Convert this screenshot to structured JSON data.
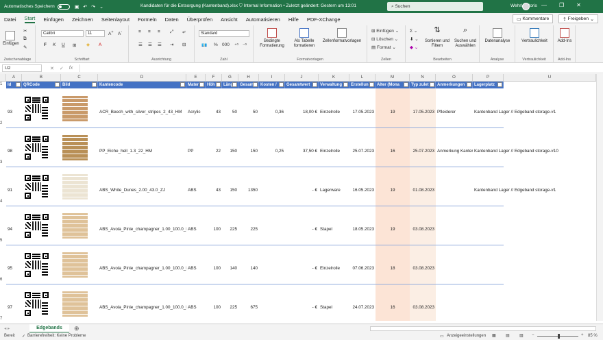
{
  "titlebar": {
    "autosave": "Automatisches Speichern",
    "filename": "Kandidaten für die Entsorgung (Kantenband).xlsx",
    "info": "Internal Information • Zuletzt geändert: Gestern um 13:01",
    "search": "Suchen",
    "user": "Wehrle, Boris"
  },
  "menu": {
    "items": [
      "Datei",
      "Start",
      "Einfügen",
      "Zeichnen",
      "Seitenlayout",
      "Formeln",
      "Daten",
      "Überprüfen",
      "Ansicht",
      "Automatisieren",
      "Hilfe",
      "PDF-XChange"
    ],
    "kommentare": "Kommentare",
    "freigeben": "Freigeben"
  },
  "ribbon": {
    "einfuegen": "Einfügen",
    "clip_label": "Zwischenablage",
    "font": "Calibri",
    "size": "11",
    "font_label": "Schriftart",
    "align_label": "Ausrichtung",
    "numfmt": "Standard",
    "num_label": "Zahl",
    "bedingte": "Bedingte Formatierung",
    "tabelle": "Als Tabelle formatieren",
    "zellenformat": "Zellenformatvorlagen",
    "formatvorlagen_label": "Formatvorlagen",
    "z_einfuegen": "Einfügen",
    "z_loeschen": "Löschen",
    "z_format": "Format",
    "zellen_label": "Zellen",
    "sortieren": "Sortieren und Filtern",
    "suchen": "Suchen und Auswählen",
    "bearbeiten_label": "Bearbeiten",
    "datenanalyse": "Datenanalyse",
    "analyse_label": "Analyse",
    "vertraulichkeit": "Vertraulichkeit",
    "vertr_label": "Vertraulichkeit",
    "addins": "Add-Ins",
    "addins_label": "Add-Ins"
  },
  "formula": {
    "namebox": "U2",
    "fx": "fx"
  },
  "columns": [
    "A",
    "B",
    "C",
    "D",
    "E",
    "F",
    "G",
    "H",
    "I",
    "J",
    "K",
    "L",
    "M",
    "N",
    "O",
    "P",
    "Q",
    "R",
    "S",
    "T",
    "U"
  ],
  "headers": [
    "Id",
    "QRCode",
    "Bild",
    "Kantencode",
    "Mater",
    "Höh",
    "Läng",
    "Gesam",
    "Kosten /",
    "Gesamtwert",
    "Verwaltung",
    "Erstellun",
    "Alter (Mona",
    "Typ zulet",
    "Anmerkungen",
    "Lagerplatz"
  ],
  "rows": [
    {
      "rn": "2",
      "id": "93",
      "code": "ACR_Beech_with_silver_stripes_2_43_HM",
      "mat": "Acrylic",
      "h": "43",
      "l": "50",
      "g": "50",
      "k": "0,36",
      "gw": "18,00 €",
      "v": "Einzelrolle",
      "e": "17.05.2023",
      "a": "19",
      "t": "17.05.2023",
      "an": "Pfleiderer",
      "lp": "Kantenband Lager // Edgeband storage-#1",
      "img": "#c99a6a"
    },
    {
      "rn": "3",
      "id": "98",
      "code": "PP_Eiche_hell_1.3_22_HM",
      "mat": "PP",
      "h": "22",
      "l": "150",
      "g": "150",
      "k": "0,25",
      "gw": "37,50 €",
      "v": "Einzelrolle",
      "e": "25.07.2023",
      "a": "16",
      "t": "25.07.2023",
      "an": "Anmerkung Kanter",
      "lp": "Kantenband Lager // Edgeband storage-#10",
      "img": "#b99057"
    },
    {
      "rn": "4",
      "id": "91",
      "code": "ABS_White_Dunes_2.00_43.0_ZJ",
      "mat": "ABS",
      "h": "43",
      "l": "150",
      "g": "1350",
      "k": "",
      "gw": "-   €",
      "v": "Lagerware",
      "e": "16.05.2023",
      "a": "19",
      "t": "01.08.2023",
      "an": "",
      "lp": "Kantenband Lager // Edgeband storage-#1",
      "img": "#ece4d3"
    },
    {
      "rn": "5",
      "id": "94",
      "code": "ABS_Avola_Pinie_champagner_1.00_100.0_HM",
      "mat": "ABS",
      "h": "100",
      "l": "225",
      "g": "225",
      "k": "",
      "gw": "-   €",
      "v": "Stapel",
      "e": "18.05.2023",
      "a": "19",
      "t": "03.08.2023",
      "an": "",
      "lp": "",
      "img": "#dfc299"
    },
    {
      "rn": "6",
      "id": "95",
      "code": "ABS_Avola_Pinie_champagner_1.00_100.0_HM",
      "mat": "ABS",
      "h": "100",
      "l": "140",
      "g": "140",
      "k": "",
      "gw": "-   €",
      "v": "Einzelrolle",
      "e": "07.06.2023",
      "a": "18",
      "t": "03.08.2023",
      "an": "",
      "lp": "",
      "img": "#dfc299"
    },
    {
      "rn": "7",
      "id": "97",
      "code": "ABS_Avola_Pinie_champagner_1.00_100.0_HM",
      "mat": "ABS",
      "h": "100",
      "l": "225",
      "g": "675",
      "k": "",
      "gw": "-   €",
      "v": "Stapel",
      "e": "24.07.2023",
      "a": "16",
      "t": "03.08.2023",
      "an": "",
      "lp": "",
      "img": "#dfc299"
    }
  ],
  "sheet": {
    "tab": "Edgebands"
  },
  "status": {
    "ready": "Bereit",
    "access": "Barrierefreiheit: Keine Probleme",
    "display": "Anzeigeeinstellungen",
    "zoom": "85 %"
  },
  "colors": {
    "excel_green": "#217346",
    "table_header": "#4472c4",
    "alter_fill": "#fce4d6"
  }
}
